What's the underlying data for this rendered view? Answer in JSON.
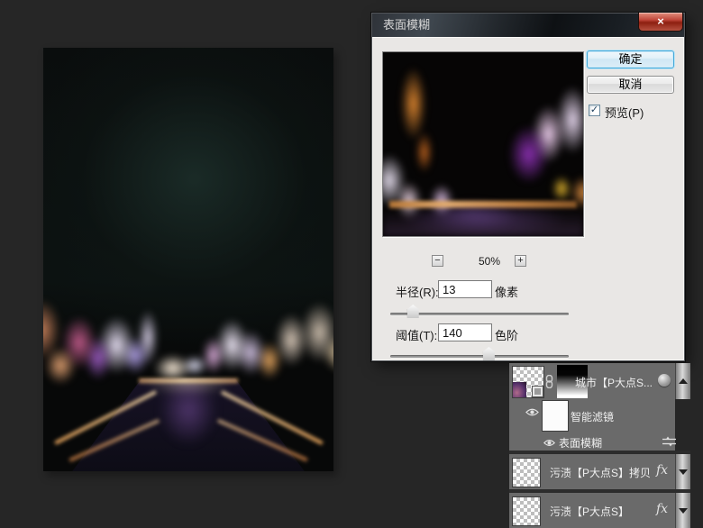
{
  "dialog": {
    "title": "表面模糊",
    "close": "×",
    "ok": "确定",
    "cancel": "取消",
    "checkbox_check": "✓",
    "preview_label": "预览(P)",
    "zoom_out": "−",
    "zoom_level": "50%",
    "zoom_in": "+",
    "radius_label": "半径(R):",
    "radius_value": "13",
    "radius_unit": "像素",
    "radius_thumb_style": "left:13%",
    "threshold_label": "阈值(T):",
    "threshold_value": "140",
    "threshold_unit": "色阶",
    "threshold_thumb_style": "left:55.5%"
  },
  "layers": {
    "top_layer_name": "城市【P大点S...",
    "smart_filters_label": "智能滤镜",
    "filter_item_label": "表面模糊",
    "copy_layer_name": "污渍【P大点S】拷贝",
    "base_layer_name": "污渍【P大点S】",
    "fx_label": "fx"
  },
  "colors": {
    "workspace_bg": "#262626",
    "panel_row_bg": "#6a6a6a",
    "dialog_bg": "#e9e7e5",
    "focus_ring_blue": "#45a8d8",
    "close_button_red": "#b5372a"
  }
}
